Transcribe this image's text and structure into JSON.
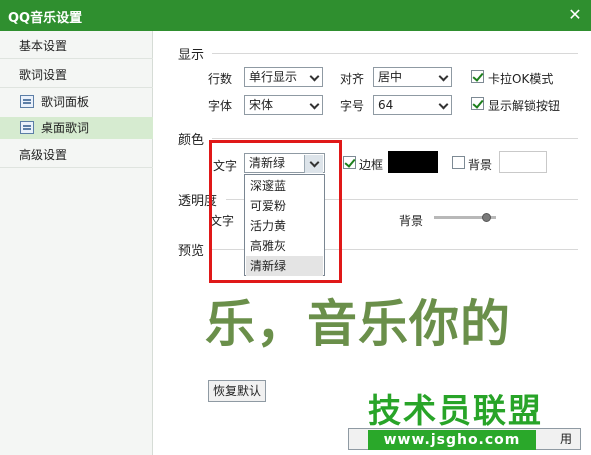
{
  "window": {
    "title": "QQ音乐设置",
    "close_glyph": "✕"
  },
  "sidebar": {
    "items": [
      {
        "label": "基本设置"
      },
      {
        "label": "歌词设置"
      },
      {
        "label": "歌词面板",
        "icon": "panel-icon"
      },
      {
        "label": "桌面歌词",
        "icon": "desktop-lyrics-icon",
        "selected": true
      },
      {
        "label": "高级设置"
      }
    ]
  },
  "display": {
    "section_label": "显示",
    "rows_label": "行数",
    "rows_value": "单行显示",
    "align_label": "对齐",
    "align_value": "居中",
    "karaoke_label": "卡拉OK模式",
    "karaoke_checked": true,
    "font_label": "字体",
    "font_value": "宋体",
    "size_label": "字号",
    "size_value": "64",
    "unlock_label": "显示解锁按钮",
    "unlock_checked": true
  },
  "color": {
    "section_label": "颜色",
    "text_label": "文字",
    "text_value": "清新绿",
    "border_label": "边框",
    "border_checked": true,
    "border_color": "#000000",
    "background_label": "背景",
    "background_checked": false,
    "background_color": "#ffffff",
    "options": [
      "深邃蓝",
      "可爱粉",
      "活力黄",
      "高雅灰",
      "清新绿"
    ],
    "selected_option": "清新绿"
  },
  "transparency": {
    "section_label": "透明度",
    "text_label": "文字",
    "background_label": "背景",
    "background_level": 0.85
  },
  "preview": {
    "section_label": "预览",
    "sample_text": "乐，音乐你的"
  },
  "buttons": {
    "restore_default": "恢复默认",
    "partial_right": "用"
  },
  "watermark": {
    "title": "技术员联盟",
    "url": "www.jsgho.com"
  },
  "colors": {
    "titlebar": "#2f8f2f",
    "highlight": "#e01818",
    "watermark_green": "#28a428"
  }
}
